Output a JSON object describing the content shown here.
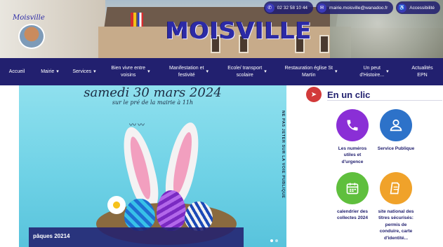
{
  "header": {
    "site_title": "MOISVILLE",
    "logo_text": "Moisville",
    "phone": "02 32 58 10 44",
    "email": "mairie.moisville@wanadoo.fr",
    "accessibility": "Accessibilité",
    "icons": {
      "phone": "phone-icon",
      "email": "mail-icon",
      "accessibility": "accessibility-icon"
    }
  },
  "nav": {
    "items": [
      {
        "label": "Accueil",
        "has_dropdown": false
      },
      {
        "label": "Mairie",
        "has_dropdown": true
      },
      {
        "label": "Services",
        "has_dropdown": true
      },
      {
        "label": "Bien vivre entre\nvoisins",
        "has_dropdown": true
      },
      {
        "label": "Manifestation et\nfestivité",
        "has_dropdown": true
      },
      {
        "label": "Ecole/ transport\nscolaire",
        "has_dropdown": true
      },
      {
        "label": "Restauration église St\nMartin",
        "has_dropdown": true
      },
      {
        "label": "Un peut\nd'Histoire...",
        "has_dropdown": true
      },
      {
        "label": "Actualités\nEPN",
        "has_dropdown": false
      }
    ]
  },
  "banner": {
    "date": "samedi 30 mars 2024",
    "subtitle": "sur le pré de la mairie à 11h",
    "side_text": "NE PAS JETER SUR LA VOIE PUBLIQUE",
    "caption": "pâques 20214",
    "slides_total": 2,
    "active_slide": 1
  },
  "en_un_clic": {
    "title": "En un clic",
    "tiles": [
      {
        "label": "Les numéros\nutiles et\nd'urgence",
        "icon": "phone-icon",
        "color": "#8a2fd6"
      },
      {
        "label": "Service Publique",
        "icon": "user-icon",
        "color": "#2d72c9"
      },
      {
        "label": "calendrier des\ncollectes 2024",
        "icon": "calendar-icon",
        "color": "#5fbf3d"
      },
      {
        "label": "site national des\ntitres sécurisés:\npermis de\nconduire, carte\nd'identité...",
        "icon": "document-icon",
        "color": "#f0a22a"
      }
    ]
  },
  "colors": {
    "nav_bg": "#22206f",
    "title": "#2c2aa6",
    "clic_accent": "#d23a3a"
  }
}
